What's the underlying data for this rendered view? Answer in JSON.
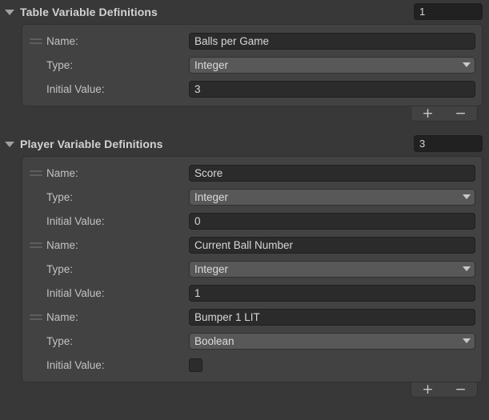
{
  "theme": {
    "background": "#383838",
    "panel": "#424242",
    "text_field": "#2b2b2b",
    "dropdown": "#585858",
    "label_text": "#c2c2c2",
    "header_text": "#d2d2d2"
  },
  "sections": [
    {
      "title": "Table Variable Definitions",
      "foldout_expanded": true,
      "size_value": "1",
      "entries": [
        {
          "name_label": "Name:",
          "name_value": "Balls per Game",
          "type_label": "Type:",
          "type_value": "Integer",
          "initial_label": "Initial Value:",
          "initial_kind": "text",
          "initial_value": "3"
        }
      ],
      "add_label": "+",
      "remove_label": "−"
    },
    {
      "title": "Player Variable Definitions",
      "foldout_expanded": true,
      "size_value": "3",
      "entries": [
        {
          "name_label": "Name:",
          "name_value": "Score",
          "type_label": "Type:",
          "type_value": "Integer",
          "initial_label": "Initial Value:",
          "initial_kind": "text",
          "initial_value": "0"
        },
        {
          "name_label": "Name:",
          "name_value": "Current Ball Number",
          "type_label": "Type:",
          "type_value": "Integer",
          "initial_label": "Initial Value:",
          "initial_kind": "text",
          "initial_value": "1"
        },
        {
          "name_label": "Name:",
          "name_value": "Bumper 1 LIT",
          "type_label": "Type:",
          "type_value": "Boolean",
          "initial_label": "Initial Value:",
          "initial_kind": "checkbox",
          "initial_checked": false
        }
      ],
      "add_label": "+",
      "remove_label": "−"
    }
  ]
}
